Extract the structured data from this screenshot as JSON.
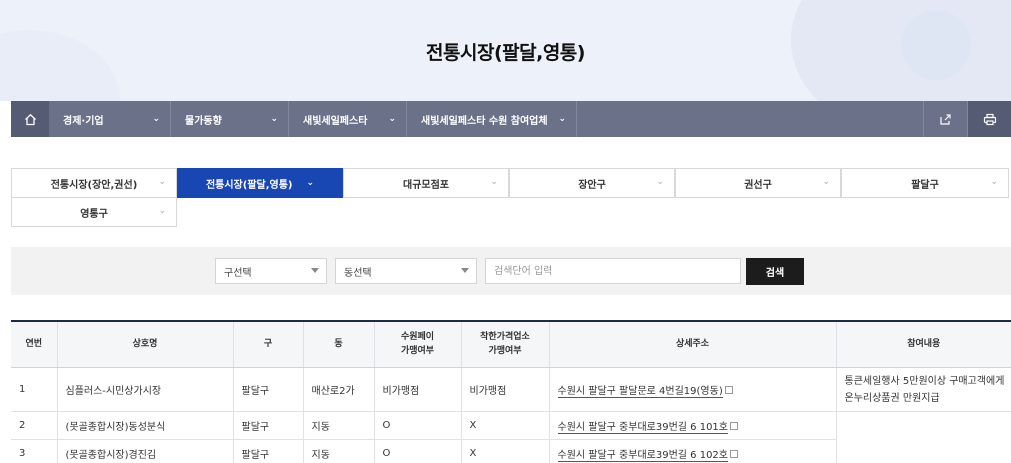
{
  "page": {
    "title": "전통시장(팔달,영통)"
  },
  "gnb": {
    "crumbs": [
      "경제·기업",
      "물가동향",
      "새빛세일페스타",
      "새빛세일페스타 수원 참여업체"
    ]
  },
  "tabs": [
    "전통시장(장안,권선)",
    "전통시장(팔달,영통)",
    "대규모점포",
    "장안구",
    "권선구",
    "팔달구",
    "영통구"
  ],
  "active_tab": "전통시장(팔달,영통)",
  "search": {
    "gu_select": "구선택",
    "dong_select": "동선택",
    "keyword_placeholder": "검색단어 입력",
    "button": "검색"
  },
  "table": {
    "headers": [
      "연번",
      "상호명",
      "구",
      "동",
      "수원페이\n가맹여부",
      "착한가격업소\n가맹여부",
      "상세주소",
      "참여내용"
    ],
    "rows": [
      {
        "no": "1",
        "name": "심플러스-시민상가시장",
        "gu": "팔달구",
        "dong": "매산로2가",
        "pay": "비가맹점",
        "good": "비가맹점",
        "addr": "수원시 팔달구 팔달문로 4번길19(영동)",
        "note": "통큰세일행사 5만원이상 구매고객에게 온누리상품권 만원지급"
      },
      {
        "no": "2",
        "name": "(못골종합시장)동성분식",
        "gu": "팔달구",
        "dong": "지동",
        "pay": "O",
        "good": "X",
        "addr": "수원시 팔달구 중부대로39번길 6 101호",
        "note": ""
      },
      {
        "no": "3",
        "name": "(못골종합시장)경진김",
        "gu": "팔달구",
        "dong": "지동",
        "pay": "O",
        "good": "X",
        "addr": "수원시 팔달구 중부대로39번길 6 102호",
        "note": ""
      }
    ]
  }
}
